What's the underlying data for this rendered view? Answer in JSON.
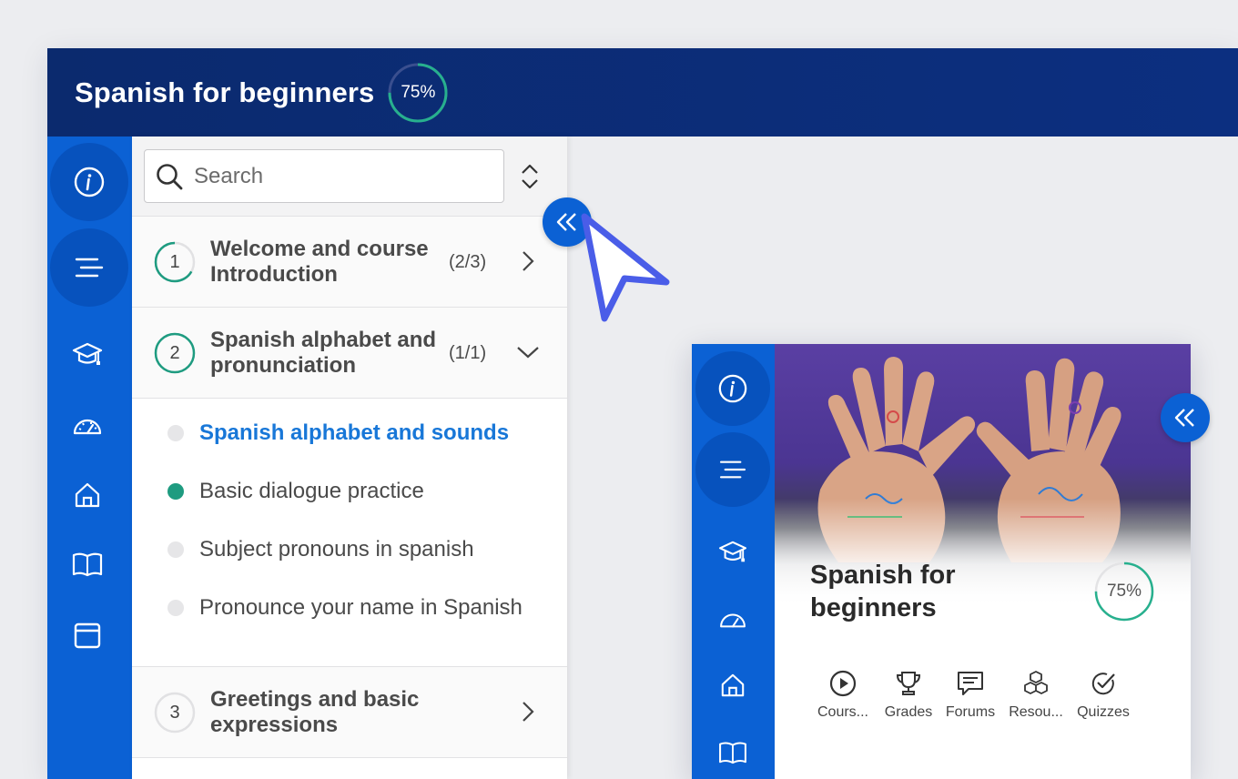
{
  "app": {
    "title": "Spanish for beginners",
    "progress_label": "75%",
    "progress_value": 0.75,
    "accent": "#0b61d4",
    "header_bg": "#0b2a6e",
    "progress_color": "#27b08e"
  },
  "rail": {
    "items": [
      {
        "icon": "info-icon"
      },
      {
        "icon": "menu-icon"
      },
      {
        "icon": "graduation-cap-icon"
      },
      {
        "icon": "dashboard-gauge-icon"
      },
      {
        "icon": "home-icon"
      },
      {
        "icon": "book-icon"
      },
      {
        "icon": "calendar-icon"
      }
    ]
  },
  "search": {
    "placeholder": "Search"
  },
  "sections": [
    {
      "num": "1",
      "title": "Welcome and course Introduction",
      "count": "(2/3)",
      "expanded": false,
      "progress": 0.66
    },
    {
      "num": "2",
      "title": "Spanish alphabet and pronunciation",
      "count": "(1/1)",
      "expanded": true,
      "progress": 1.0
    },
    {
      "num": "3",
      "title": "Greetings and basic expressions",
      "count": "",
      "expanded": false,
      "progress": 0
    }
  ],
  "lessons": [
    {
      "label": "Spanish alphabet and sounds",
      "state": "active"
    },
    {
      "label": "Basic dialogue practice",
      "state": "done"
    },
    {
      "label": "Subject pronouns in spanish",
      "state": "todo"
    },
    {
      "label": "Pronounce your name in Spanish",
      "state": "todo"
    }
  ],
  "mobile": {
    "title": "Spanish for beginners",
    "progress_label": "75%",
    "nav": [
      {
        "label": "Cours...",
        "icon": "play-circle-icon"
      },
      {
        "label": "Grades",
        "icon": "trophy-icon"
      },
      {
        "label": "Forums",
        "icon": "forum-chat-icon"
      },
      {
        "label": "Resou...",
        "icon": "cubes-icon"
      },
      {
        "label": "Quizzes",
        "icon": "check-circle-icon"
      }
    ]
  }
}
